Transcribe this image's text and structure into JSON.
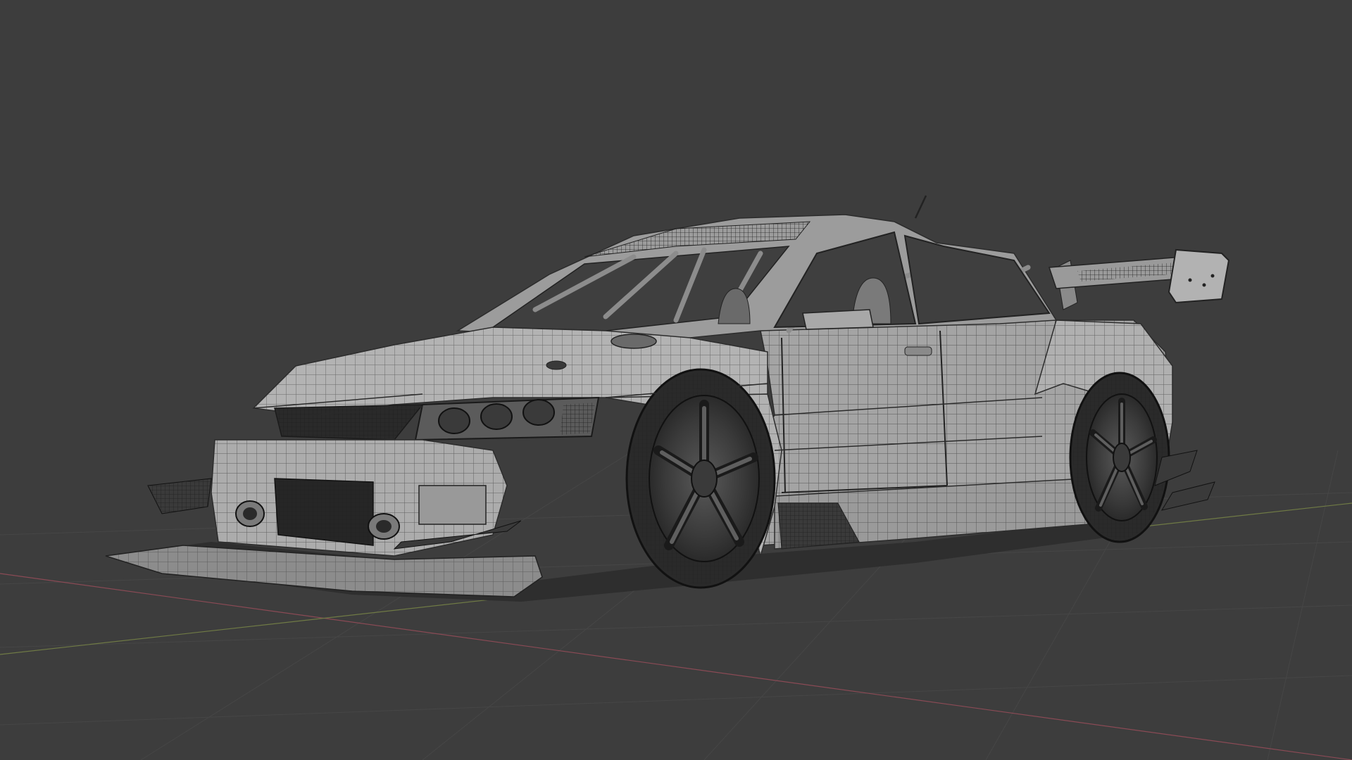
{
  "viewport": {
    "background": "#3d3d3d",
    "grid_color": "#474747",
    "axis_x_color": "#8a4a55",
    "axis_y_color": "#6f7a45"
  },
  "model": {
    "body_color": "#a9a9a9",
    "body_shade": "#8d8d8d",
    "body_light": "#bdbdbd",
    "wire_color": "#2c2c2c",
    "dark_part": "#262626",
    "glass_color": "#4a4a4a"
  }
}
